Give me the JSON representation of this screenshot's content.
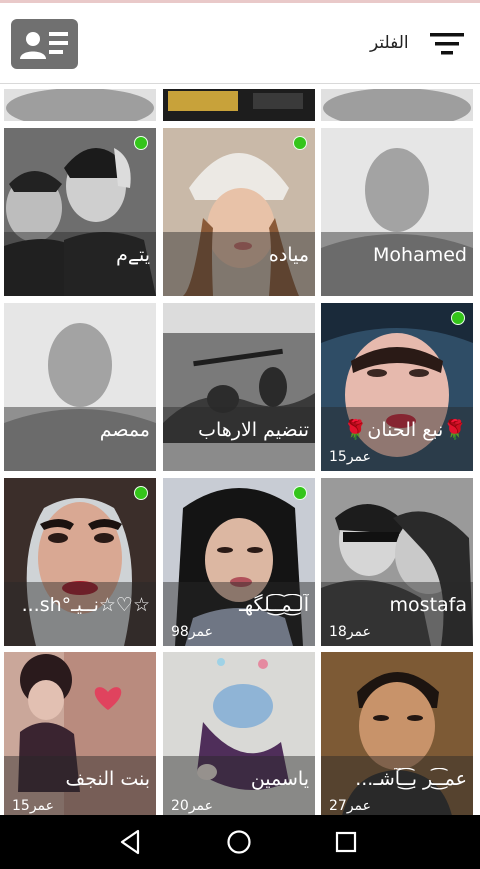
{
  "header": {
    "filter_label": "الفلتر",
    "filter_icon": "filter-icon",
    "profile_icon": "profile-card-icon"
  },
  "tiles": [
    {
      "name": "",
      "age": "",
      "online": false,
      "photo": "partial-placeholder"
    },
    {
      "name": "",
      "age": "",
      "online": false,
      "photo": "partial-banner"
    },
    {
      "name": "",
      "age": "",
      "online": false,
      "photo": "partial-placeholder"
    },
    {
      "name": "Mohamed",
      "age": "",
      "online": false,
      "photo": "placeholder"
    },
    {
      "name": "مياده",
      "age": "",
      "online": true,
      "photo": "photo-girl-hat"
    },
    {
      "name": "يتےم",
      "age": "",
      "online": true,
      "photo": "photo-boys-bw"
    },
    {
      "name": "🌹نبع الحنان🌹",
      "age": "15عمر",
      "online": true,
      "photo": "photo-face-red-lips"
    },
    {
      "name": "تنضيم الارهاب",
      "age": "",
      "online": false,
      "photo": "photo-soldiers"
    },
    {
      "name": "ممصم",
      "age": "",
      "online": false,
      "photo": "placeholder"
    },
    {
      "name": "mostafa",
      "age": "18عمر",
      "online": false,
      "photo": "photo-couple-bw"
    },
    {
      "name": "آلـ͜͡مـ͜͡ـلگهـ",
      "age": "98عمر",
      "online": true,
      "photo": "photo-woman-dark-hair"
    },
    {
      "name": "☆♡☆نــيـ°sh...",
      "age": "",
      "online": true,
      "photo": "photo-woman-eyes"
    },
    {
      "name": "عمـ͜͡ـر بـ͜͡ـآشـ...",
      "age": "27عمر",
      "online": false,
      "photo": "photo-young-man"
    },
    {
      "name": "ياسمين",
      "age": "20عمر",
      "online": false,
      "photo": "photo-girl-sitting"
    },
    {
      "name": "بنت النجف",
      "age": "15عمر",
      "online": false,
      "photo": "photo-girl-heart"
    }
  ],
  "navbar": {
    "back": "back-icon",
    "home": "home-icon",
    "recents": "recents-icon"
  },
  "colors": {
    "online": "#34c51a",
    "header_button": "#707070",
    "navbar": "#000000"
  }
}
